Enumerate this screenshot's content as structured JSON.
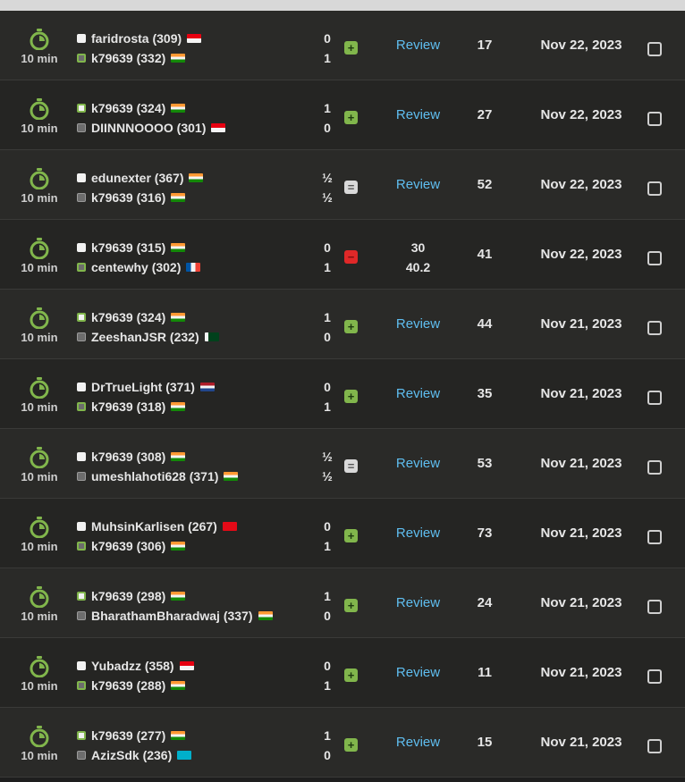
{
  "colors": {
    "win": "#81b64c",
    "draw": "#d9d9d9",
    "loss": "#e02828",
    "review_link": "#5fbef0"
  },
  "games": [
    {
      "mode": "10 min",
      "players": [
        {
          "name": "faridrosta (309)",
          "piece": "white",
          "winner": false,
          "flag": "id"
        },
        {
          "name": "k79639 (332)",
          "piece": "black",
          "winner": true,
          "flag": "in"
        }
      ],
      "scores": [
        "0",
        "1"
      ],
      "result": "win",
      "result_symbol": "+",
      "accuracy": "Review",
      "moves": "17",
      "date": "Nov 22, 2023"
    },
    {
      "mode": "10 min",
      "players": [
        {
          "name": "k79639 (324)",
          "piece": "white",
          "winner": true,
          "flag": "in"
        },
        {
          "name": "DIINNNOOOO (301)",
          "piece": "black",
          "winner": false,
          "flag": "id"
        }
      ],
      "scores": [
        "1",
        "0"
      ],
      "result": "win",
      "result_symbol": "+",
      "accuracy": "Review",
      "moves": "27",
      "date": "Nov 22, 2023"
    },
    {
      "mode": "10 min",
      "players": [
        {
          "name": "edunexter (367)",
          "piece": "white",
          "winner": false,
          "flag": "in"
        },
        {
          "name": "k79639 (316)",
          "piece": "black",
          "winner": false,
          "flag": "in"
        }
      ],
      "scores": [
        "½",
        "½"
      ],
      "result": "draw",
      "result_symbol": "=",
      "accuracy": "Review",
      "moves": "52",
      "date": "Nov 22, 2023"
    },
    {
      "mode": "10 min",
      "players": [
        {
          "name": "k79639 (315)",
          "piece": "white",
          "winner": false,
          "flag": "in"
        },
        {
          "name": "centewhy (302)",
          "piece": "black",
          "winner": true,
          "flag": "fr"
        }
      ],
      "scores": [
        "0",
        "1"
      ],
      "result": "loss",
      "result_symbol": "−",
      "accuracy_values": [
        "30",
        "40.2"
      ],
      "moves": "41",
      "date": "Nov 22, 2023"
    },
    {
      "mode": "10 min",
      "players": [
        {
          "name": "k79639 (324)",
          "piece": "white",
          "winner": true,
          "flag": "in"
        },
        {
          "name": "ZeeshanJSR (232)",
          "piece": "black",
          "winner": false,
          "flag": "pk"
        }
      ],
      "scores": [
        "1",
        "0"
      ],
      "result": "win",
      "result_symbol": "+",
      "accuracy": "Review",
      "moves": "44",
      "date": "Nov 21, 2023"
    },
    {
      "mode": "10 min",
      "players": [
        {
          "name": "DrTrueLight (371)",
          "piece": "white",
          "winner": false,
          "flag": "nl"
        },
        {
          "name": "k79639 (318)",
          "piece": "black",
          "winner": true,
          "flag": "in"
        }
      ],
      "scores": [
        "0",
        "1"
      ],
      "result": "win",
      "result_symbol": "+",
      "accuracy": "Review",
      "moves": "35",
      "date": "Nov 21, 2023"
    },
    {
      "mode": "10 min",
      "players": [
        {
          "name": "k79639 (308)",
          "piece": "white",
          "winner": false,
          "flag": "in"
        },
        {
          "name": "umeshlahoti628 (371)",
          "piece": "black",
          "winner": false,
          "flag": "in"
        }
      ],
      "scores": [
        "½",
        "½"
      ],
      "result": "draw",
      "result_symbol": "=",
      "accuracy": "Review",
      "moves": "53",
      "date": "Nov 21, 2023"
    },
    {
      "mode": "10 min",
      "players": [
        {
          "name": "MuhsinKarlisen (267)",
          "piece": "white",
          "winner": false,
          "flag": "tr"
        },
        {
          "name": "k79639 (306)",
          "piece": "black",
          "winner": true,
          "flag": "in"
        }
      ],
      "scores": [
        "0",
        "1"
      ],
      "result": "win",
      "result_symbol": "+",
      "accuracy": "Review",
      "moves": "73",
      "date": "Nov 21, 2023"
    },
    {
      "mode": "10 min",
      "players": [
        {
          "name": "k79639 (298)",
          "piece": "white",
          "winner": true,
          "flag": "in"
        },
        {
          "name": "BharathamBharadwaj (337)",
          "piece": "black",
          "winner": false,
          "flag": "in"
        }
      ],
      "scores": [
        "1",
        "0"
      ],
      "result": "win",
      "result_symbol": "+",
      "accuracy": "Review",
      "moves": "24",
      "date": "Nov 21, 2023"
    },
    {
      "mode": "10 min",
      "players": [
        {
          "name": "Yubadzz (358)",
          "piece": "white",
          "winner": false,
          "flag": "id"
        },
        {
          "name": "k79639 (288)",
          "piece": "black",
          "winner": true,
          "flag": "in"
        }
      ],
      "scores": [
        "0",
        "1"
      ],
      "result": "win",
      "result_symbol": "+",
      "accuracy": "Review",
      "moves": "11",
      "date": "Nov 21, 2023"
    },
    {
      "mode": "10 min",
      "players": [
        {
          "name": "k79639 (277)",
          "piece": "white",
          "winner": true,
          "flag": "in"
        },
        {
          "name": "AzizSdk (236)",
          "piece": "black",
          "winner": false,
          "flag": "kz"
        }
      ],
      "scores": [
        "1",
        "0"
      ],
      "result": "win",
      "result_symbol": "+",
      "accuracy": "Review",
      "moves": "15",
      "date": "Nov 21, 2023"
    }
  ]
}
